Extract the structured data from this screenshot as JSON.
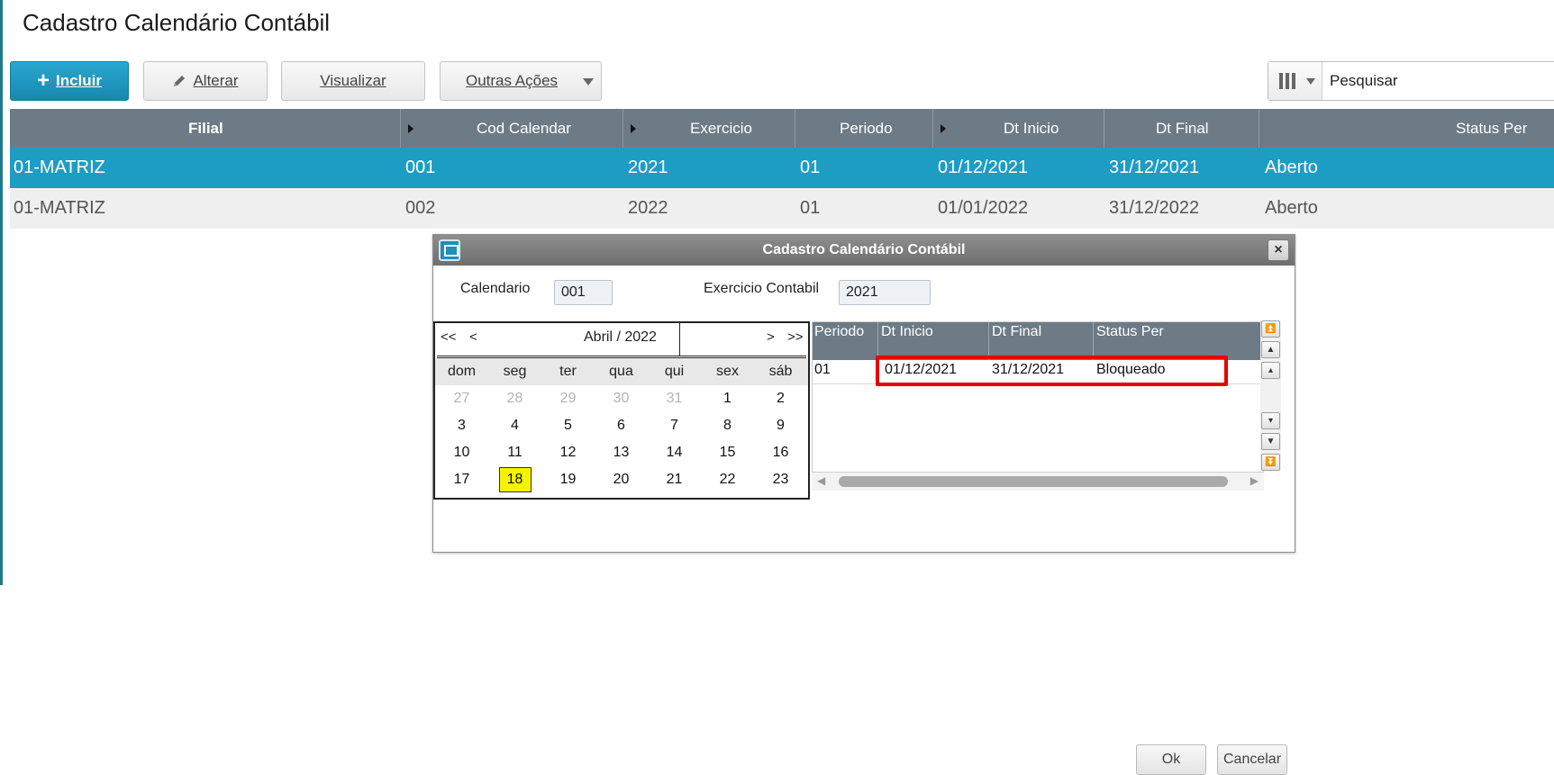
{
  "page": {
    "title": "Cadastro Calendário Contábil"
  },
  "toolbar": {
    "incluir_label": "Incluir",
    "alterar_label": "Alterar",
    "visualizar_label": "Visualizar",
    "outras_label": "Outras Ações",
    "search_placeholder": "Pesquisar"
  },
  "grid": {
    "columns": [
      "Filial",
      "Cod Calendar",
      "Exercicio",
      "Periodo",
      "Dt Inicio",
      "Dt Final",
      "Status Per"
    ],
    "rows": [
      [
        "01-MATRIZ",
        "001",
        "2021",
        "01",
        "01/12/2021",
        "31/12/2021",
        "Aberto"
      ],
      [
        "01-MATRIZ",
        "002",
        "2022",
        "01",
        "01/01/2022",
        "31/12/2022",
        "Aberto"
      ]
    ]
  },
  "dialog": {
    "title": "Cadastro Calendário Contábil",
    "close": "×",
    "calendario_label": "Calendario",
    "calendario_value": "001",
    "exercicio_label": "Exercicio Contabil",
    "exercicio_value": "2021",
    "calendar": {
      "prev_year": "<<",
      "prev_month": "<",
      "month_year": "Abril / 2022",
      "next_month": ">",
      "next_year": ">>",
      "weekdays": [
        "dom",
        "seg",
        "ter",
        "qua",
        "qui",
        "sex",
        "sáb"
      ],
      "weeks": [
        [
          "27",
          "28",
          "29",
          "30",
          "31",
          "1",
          "2"
        ],
        [
          "3",
          "4",
          "5",
          "6",
          "7",
          "8",
          "9"
        ],
        [
          "10",
          "11",
          "12",
          "13",
          "14",
          "15",
          "16"
        ],
        [
          "17",
          "18",
          "19",
          "20",
          "21",
          "22",
          "23"
        ]
      ],
      "selected_day": "18"
    },
    "period_grid": {
      "columns": [
        "Periodo",
        "Dt Inicio",
        "Dt Final",
        "Status Per"
      ],
      "rows": [
        [
          "01",
          "01/12/2021",
          "31/12/2021",
          "Bloqueado"
        ]
      ]
    },
    "ok_label": "Ok",
    "cancel_label": "Cancelar"
  },
  "colors": {
    "accent": "#1e9dc4",
    "grid_header": "#6c7b85",
    "highlight": "#e80000",
    "today": "#f5f300"
  }
}
